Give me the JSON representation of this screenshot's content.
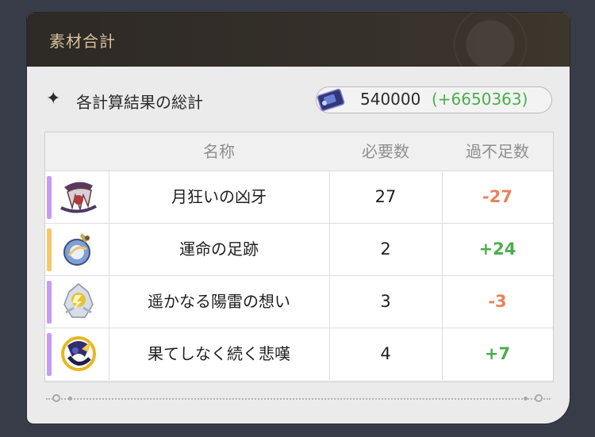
{
  "panel": {
    "title": "素材合計"
  },
  "summary": {
    "label": "各計算結果の総計",
    "star_icon": "four-point-star-icon",
    "currency_icon": "ticket-icon",
    "value": "540000",
    "delta": "(+6650363)",
    "delta_color": "#4cae4c"
  },
  "table": {
    "headers": {
      "name": "名称",
      "required": "必要数",
      "shortage": "過不足数"
    },
    "rows": [
      {
        "name": "月狂いの凶牙",
        "required": "27",
        "shortage": "-27",
        "rarity_color": "#c79bf5",
        "icon": "fang-material-icon",
        "shortage_color": "#e8835a"
      },
      {
        "name": "運命の足跡",
        "required": "2",
        "shortage": "+24",
        "rarity_color": "#f5c96b",
        "icon": "destiny-orb-icon",
        "shortage_color": "#4cae4c"
      },
      {
        "name": "遥かなる陽雷の想い",
        "required": "3",
        "shortage": "-3",
        "rarity_color": "#c79bf5",
        "icon": "thunder-crystal-icon",
        "shortage_color": "#e8835a"
      },
      {
        "name": "果てしなく続く悲嘆",
        "required": "4",
        "shortage": "+7",
        "rarity_color": "#c79bf5",
        "icon": "sorrow-ring-icon",
        "shortage_color": "#4cae4c"
      }
    ]
  }
}
